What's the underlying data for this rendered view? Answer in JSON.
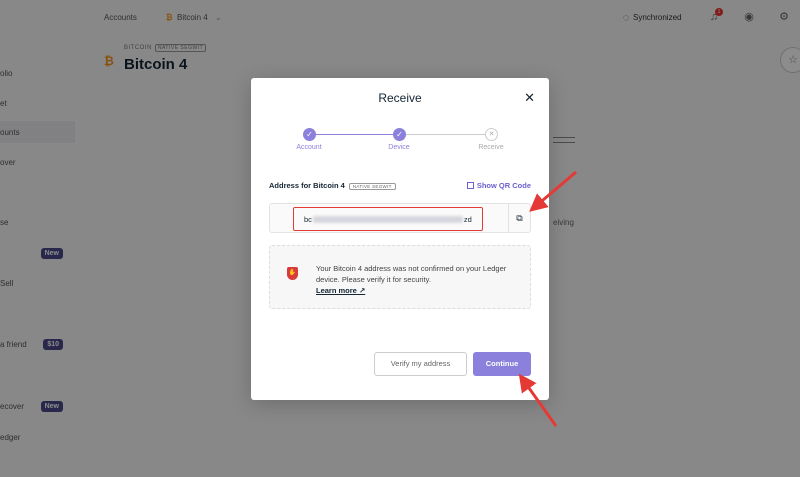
{
  "sidebar": {
    "items": [
      {
        "label": "olio"
      },
      {
        "label": "et"
      },
      {
        "label": "ounts"
      },
      {
        "label": "over"
      },
      {
        "label": "se"
      },
      {
        "label": "",
        "badge": "New"
      },
      {
        "label": " Sell"
      },
      {
        "label": "a friend",
        "badge": "$10"
      },
      {
        "label": "ecover",
        "badge": "New"
      },
      {
        "label": "edger"
      }
    ]
  },
  "topbar": {
    "accounts": "Accounts",
    "coin": "Bitcoin 4",
    "sync_status": "Synchronized",
    "notif_count": "1"
  },
  "page": {
    "subtitle": "BITCOIN",
    "subtitle_tag": "NATIVE SEGWIT",
    "title": "Bitcoin 4",
    "bg_text": "eiving"
  },
  "modal": {
    "title": "Receive",
    "steps": [
      {
        "label": "Account",
        "state": "done"
      },
      {
        "label": "Device",
        "state": "done"
      },
      {
        "label": "Receive",
        "state": "pending"
      }
    ],
    "address_label": "Address for Bitcoin 4",
    "address_tag": "NATIVE SEGWIT",
    "show_qr": "Show QR Code",
    "address_prefix": "bc",
    "address_suffix": "zd",
    "warning_text": "Your Bitcoin 4 address was not confirmed on your Ledger device. Please verify it for security.",
    "learn_more": "Learn more",
    "verify_button": "Verify my address",
    "continue_button": "Continue"
  },
  "colors": {
    "accent": "#8b80db",
    "warning_red": "#d93a3a",
    "annotation_red": "#e53935",
    "bitcoin_orange": "#f7931a"
  }
}
